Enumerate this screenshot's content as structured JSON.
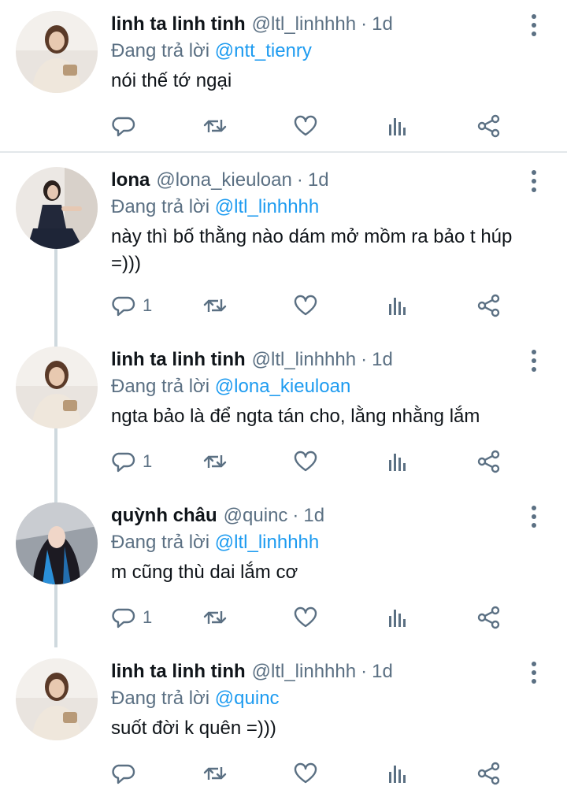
{
  "reply_prefix": "Đang trả lời",
  "dot": "·",
  "colors": {
    "text": "#0f1419",
    "secondary": "#5b7083",
    "mention": "#1d9bf0",
    "thread_line": "#cfd9de",
    "divider": "#e3e7ea"
  },
  "icons": [
    "more-icon",
    "reply-icon",
    "retweet-icon",
    "like-icon",
    "analytics-icon",
    "share-icon"
  ],
  "tweets": [
    {
      "name": "linh ta linh tinh",
      "handle": "@ltl_linhhhh",
      "time": "1d",
      "reply_to": "@ntt_tienry",
      "text": "nói thế tớ ngại",
      "reply_count": ""
    },
    {
      "name": "lona",
      "handle": "@lona_kieuloan",
      "time": "1d",
      "reply_to": "@ltl_linhhhh",
      "text": "này thì bố thằng nào dám mở mồm ra bảo t húp =)))",
      "reply_count": "1"
    },
    {
      "name": "linh ta linh tinh",
      "handle": "@ltl_linhhhh",
      "time": "1d",
      "reply_to": "@lona_kieuloan",
      "text": "ngta bảo là để ngta tán cho, lằng nhằng lắm",
      "reply_count": "1"
    },
    {
      "name": "quỳnh châu",
      "handle": "@quinc",
      "time": "1d",
      "reply_to": "@ltl_linhhhh",
      "text": "m cũng thù dai lắm cơ",
      "reply_count": "1"
    },
    {
      "name": "linh ta linh tinh",
      "handle": "@ltl_linhhhh",
      "time": "1d",
      "reply_to": "@quinc",
      "text": "suốt đời k quên =)))",
      "reply_count": ""
    }
  ]
}
